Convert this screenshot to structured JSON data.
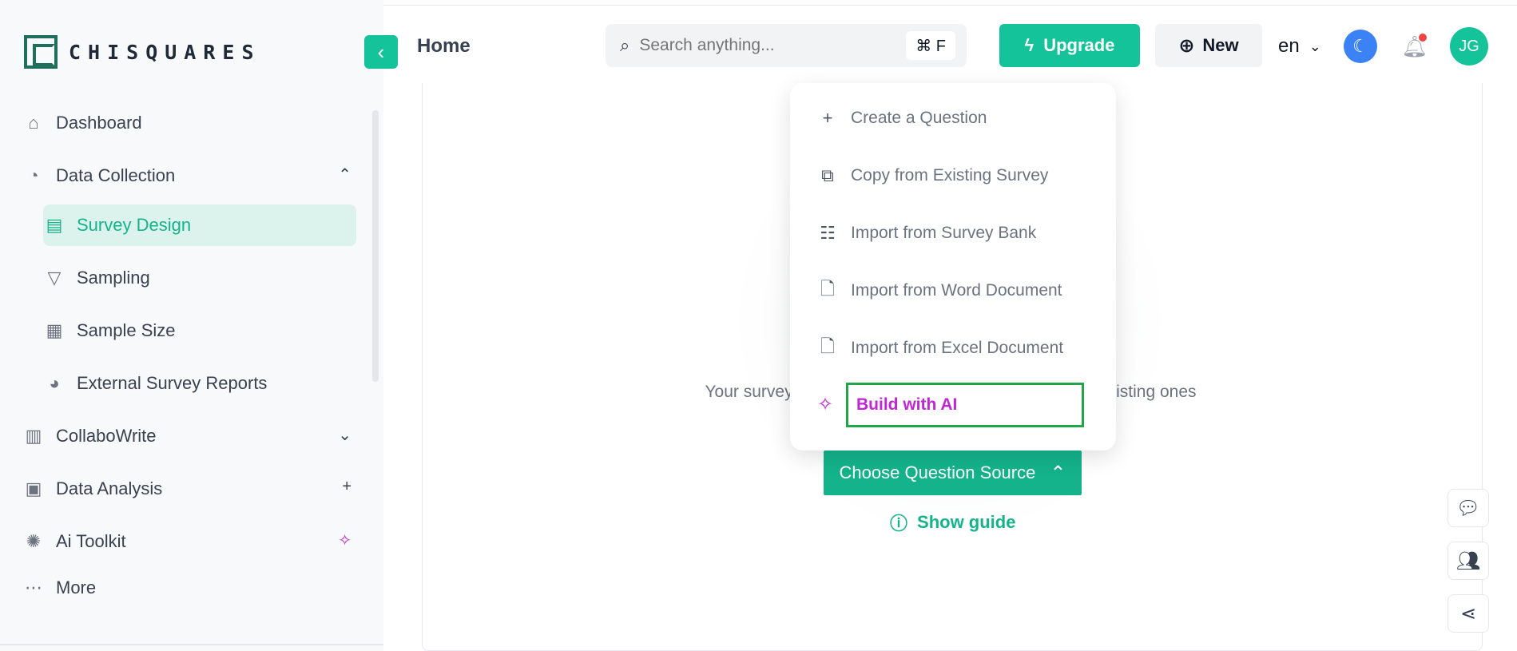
{
  "brand": {
    "name": "CHISQUARES"
  },
  "header": {
    "title": "Home",
    "search_placeholder": "Search anything...",
    "search_shortcut": "⌘ F",
    "upgrade_label": "Upgrade",
    "new_label": "New",
    "language": "en",
    "avatar_initials": "JG"
  },
  "sidebar": {
    "items": [
      {
        "label": "Dashboard",
        "icon": "home-icon"
      },
      {
        "label": "Data Collection",
        "icon": "data-collection-icon",
        "expanded": true
      },
      {
        "label": "Survey Design",
        "icon": "clipboard-icon",
        "active": true
      },
      {
        "label": "Sampling",
        "icon": "funnel-icon"
      },
      {
        "label": "Sample Size",
        "icon": "calculator-icon"
      },
      {
        "label": "External Survey Reports",
        "icon": "report-icon"
      },
      {
        "label": "CollaboWrite",
        "icon": "chart-icon"
      },
      {
        "label": "Data Analysis",
        "icon": "analysis-icon"
      },
      {
        "label": "Ai Toolkit",
        "icon": "bug-icon"
      },
      {
        "label": "More",
        "icon": "more-icon"
      }
    ]
  },
  "main": {
    "description": "Your survey, yo                                                  reuse existing ones                                                  egin.",
    "choose_label": "Choose Question Source",
    "guide_label": "Show guide"
  },
  "menu": {
    "items": [
      {
        "label": "Create a Question",
        "icon": "plus-icon"
      },
      {
        "label": "Copy from Existing Survey",
        "icon": "copy-icon"
      },
      {
        "label": "Import from Survey Bank",
        "icon": "bank-icon"
      },
      {
        "label": "Import from Word Document",
        "icon": "word-doc-icon"
      },
      {
        "label": "Import from Excel Document",
        "icon": "excel-doc-icon"
      },
      {
        "label": "Build with AI",
        "icon": "magic-wand-icon"
      }
    ]
  },
  "colors": {
    "accent": "#14c39a",
    "ai": "#c026d3",
    "highlight_border": "#22a44a",
    "theme_button": "#3b82f6"
  }
}
